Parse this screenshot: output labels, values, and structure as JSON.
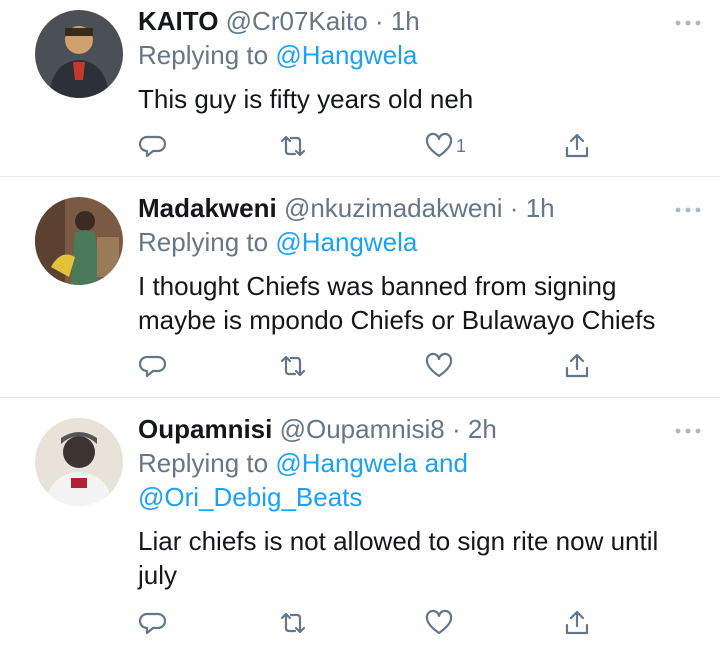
{
  "tweets": [
    {
      "name": "KAITO",
      "handle": "@Cr07Kaito",
      "dot": "·",
      "time": "1h",
      "replying_prefix": "Replying to",
      "replying_to": "@Hangwela",
      "text": "This guy is fifty years old neh",
      "like_count": "1",
      "avatar_colors": [
        "#3a3f4a",
        "#c23a2c",
        "#d8a46e"
      ]
    },
    {
      "name": "Madakweni",
      "handle": "@nkuzimadakweni",
      "dot": "·",
      "time": "1h",
      "replying_prefix": "Replying to",
      "replying_to": "@Hangwela",
      "text_line1": "I thought Chiefs was banned from signing",
      "text_line2": "maybe is mpondo Chiefs or Bulawayo Chiefs",
      "avatar_colors": [
        "#6b4a32",
        "#e2c23a",
        "#4a7a5a"
      ]
    },
    {
      "name": "Oupamnisi",
      "handle": "@Oupamnisi8",
      "dot": "·",
      "time": "2h",
      "replying_prefix": "Replying to",
      "replying_to": "@Hangwela",
      "replying_and": "and",
      "replying_to_2": "@Ori_Debig_Beats",
      "text_line1": "Liar chiefs is not allowed to sign rite now until",
      "text_line2": "july",
      "avatar_colors": [
        "#e8e2d8",
        "#3b3431",
        "#b22234"
      ]
    }
  ],
  "icons": {
    "more": "more-icon",
    "reply": "reply-icon",
    "retweet": "retweet-icon",
    "like": "heart-icon",
    "share": "share-icon"
  },
  "colors": {
    "text_primary": "#14171a",
    "text_secondary": "#657786",
    "link": "#1da1f2",
    "divider": "#e6ecf0"
  }
}
